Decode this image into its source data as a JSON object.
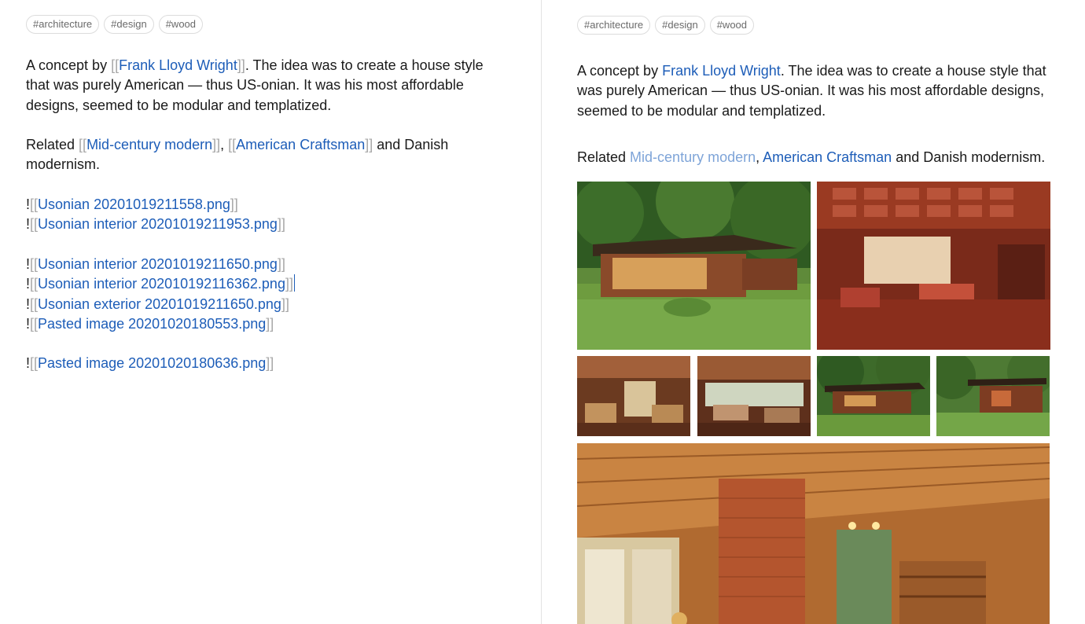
{
  "tags": [
    "#architecture",
    "#design",
    "#wood"
  ],
  "editor": {
    "line1": {
      "prefix": "A concept by ",
      "open": "[[",
      "link": "Frank Lloyd Wright",
      "close": "]]",
      "suffix": ". The idea was to create a house style that was purely American — thus US-onian. It was his most affordable designs, seemed to be modular and templatized."
    },
    "line2": {
      "prefix": "Related ",
      "link1": "Mid-century modern",
      "sep": ", ",
      "link2": "American Craftsman",
      "suffix": " and Danish modernism."
    },
    "embeds": [
      "Usonian 20201019211558.png",
      "Usonian interior 20201019211953.png",
      "Usonian interior 20201019211650.png",
      "Usonian interior  202010192116362.png",
      "Usonian exterior  20201019211650.png",
      "Pasted image 20201020180553.png",
      "Pasted image 20201020180636.png"
    ],
    "embed_prefix": "!",
    "bracket_open": "[[",
    "bracket_close": "]]"
  },
  "preview": {
    "p1_prefix": "A concept by ",
    "p1_link": "Frank Lloyd Wright",
    "p1_suffix": ". The idea was to create a house style that was purely American — thus US-onian. It was his most affordable designs, seemed to be modular and templatized.",
    "p2_prefix": "Related ",
    "p2_link1": "Mid-century modern",
    "p2_sep": ", ",
    "p2_link2": "American Craftsman",
    "p2_suffix": " and Danish modernism."
  },
  "colors": {
    "link": "#1d5db8",
    "link_unresolved": "#7ea4d8",
    "bracket": "#a8a8a8"
  }
}
